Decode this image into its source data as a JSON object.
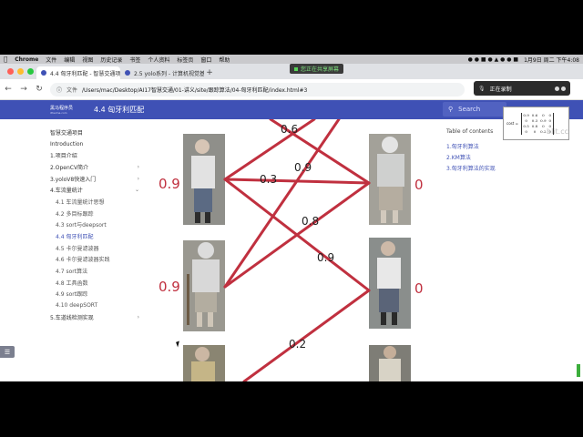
{
  "mac_menubar": {
    "app": "Chrome",
    "menus": [
      "文件",
      "编辑",
      "视图",
      "历史记录",
      "书签",
      "个人资料",
      "标签页",
      "窗口",
      "帮助"
    ],
    "clock": "1月9日 周二 下午4:08"
  },
  "share_indicator": "您正在共享屏幕",
  "tabs": [
    {
      "label": "4.4 匈牙利匹配 - 智慧交通项目",
      "active": true
    },
    {
      "label": "2.5 yolo系列 - 计算机视觉基础",
      "active": false
    }
  ],
  "address": {
    "scheme_label": "文件",
    "url": "/Users/mac/Desktop/AI17智慧交通/01-讲义/site/跟踪算法/04-匈牙利匹配/index.html#3"
  },
  "recording": {
    "label": "正在录制"
  },
  "header": {
    "logo_line1": "黑马程序员",
    "logo_line2": "itheima.com",
    "title": "4.4 匈牙利匹配",
    "search_placeholder": "Search"
  },
  "sidebar": {
    "items": [
      {
        "label": "智慧交通项目",
        "level": 0
      },
      {
        "label": "Introduction",
        "level": 0
      },
      {
        "label": "1.项目介绍",
        "level": 0
      },
      {
        "label": "2.OpenCV简介",
        "level": 0,
        "expandable": true
      },
      {
        "label": "3.yoloV8快速入门",
        "level": 0,
        "expandable": true
      },
      {
        "label": "4.车流量统计",
        "level": 0,
        "expanded": true
      },
      {
        "label": "4.1 车流量统计思想",
        "level": 1
      },
      {
        "label": "4.2 多目标跟踪",
        "level": 1
      },
      {
        "label": "4.3 sort与deepsort",
        "level": 1
      },
      {
        "label": "4.4 匈牙利匹配",
        "level": 1,
        "active": true
      },
      {
        "label": "4.5 卡尔曼滤波器",
        "level": 1
      },
      {
        "label": "4.6 卡尔曼滤波器实践",
        "level": 1
      },
      {
        "label": "4.7 sort算法",
        "level": 1
      },
      {
        "label": "4.8 工具函数",
        "level": 1
      },
      {
        "label": "4.9 sort跟踪",
        "level": 1
      },
      {
        "label": "4.10 deepSORT",
        "level": 1
      },
      {
        "label": "5.车道线检测实现",
        "level": 0,
        "expandable": true
      }
    ]
  },
  "toc": {
    "title": "Table of contents",
    "items": [
      "1.匈牙利算法",
      "2.KM算法",
      "3.匈牙利算法的实现"
    ]
  },
  "matrix_popup": {
    "label": "cost =",
    "rows": [
      [
        "0.9",
        "0.6",
        "0",
        "0"
      ],
      [
        "0",
        "0.3",
        "0.9",
        "0"
      ],
      [
        "0.5",
        "0.8",
        "0",
        "0"
      ],
      [
        "0",
        "0",
        "0.2",
        "0"
      ]
    ]
  },
  "watermark": "blit.cc",
  "figure": {
    "edge_color": "#c0303f",
    "label_color": "#c0303f",
    "left_weights": [
      "0.9",
      "0.9"
    ],
    "right_weights": [
      "0",
      "0"
    ],
    "edge_labels": [
      "0.6",
      "0.9",
      "0.3",
      "0.8",
      "0.9",
      "0.2"
    ]
  }
}
